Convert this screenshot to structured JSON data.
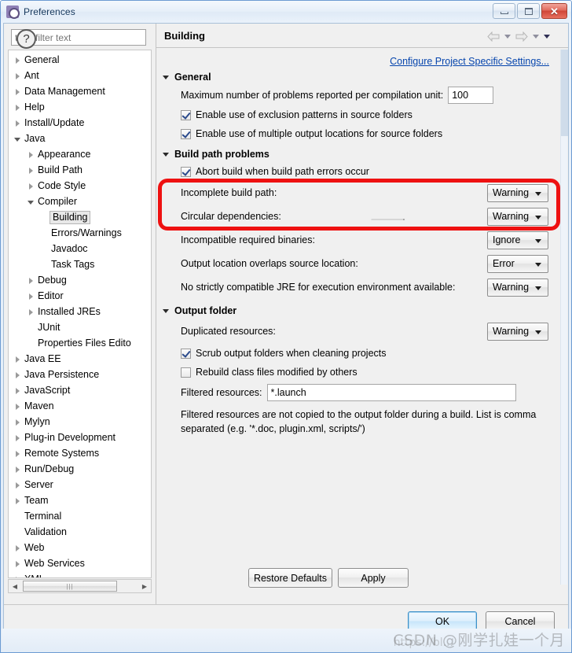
{
  "window": {
    "title": "Preferences",
    "icon": "preferences-gear-icon",
    "buttons": {
      "minimize": "minimize-icon",
      "maximize": "maximize-icon",
      "close": "✕"
    }
  },
  "sidebar": {
    "filter": {
      "value": "",
      "placeholder": "type filter text"
    },
    "items": [
      {
        "label": "General",
        "indent": 0,
        "twisty": "collapsed",
        "selected": false
      },
      {
        "label": "Ant",
        "indent": 0,
        "twisty": "collapsed",
        "selected": false
      },
      {
        "label": "Data Management",
        "indent": 0,
        "twisty": "collapsed",
        "selected": false
      },
      {
        "label": "Help",
        "indent": 0,
        "twisty": "collapsed",
        "selected": false
      },
      {
        "label": "Install/Update",
        "indent": 0,
        "twisty": "collapsed",
        "selected": false
      },
      {
        "label": "Java",
        "indent": 0,
        "twisty": "expanded",
        "selected": false
      },
      {
        "label": "Appearance",
        "indent": 1,
        "twisty": "collapsed",
        "selected": false
      },
      {
        "label": "Build Path",
        "indent": 1,
        "twisty": "collapsed",
        "selected": false
      },
      {
        "label": "Code Style",
        "indent": 1,
        "twisty": "collapsed",
        "selected": false
      },
      {
        "label": "Compiler",
        "indent": 1,
        "twisty": "expanded",
        "selected": false
      },
      {
        "label": "Building",
        "indent": 2,
        "twisty": "none",
        "selected": true
      },
      {
        "label": "Errors/Warnings",
        "indent": 2,
        "twisty": "none",
        "selected": false
      },
      {
        "label": "Javadoc",
        "indent": 2,
        "twisty": "none",
        "selected": false
      },
      {
        "label": "Task Tags",
        "indent": 2,
        "twisty": "none",
        "selected": false
      },
      {
        "label": "Debug",
        "indent": 1,
        "twisty": "collapsed",
        "selected": false
      },
      {
        "label": "Editor",
        "indent": 1,
        "twisty": "collapsed",
        "selected": false
      },
      {
        "label": "Installed JREs",
        "indent": 1,
        "twisty": "collapsed",
        "selected": false
      },
      {
        "label": "JUnit",
        "indent": 1,
        "twisty": "none",
        "selected": false
      },
      {
        "label": "Properties Files Edito",
        "indent": 1,
        "twisty": "none",
        "selected": false
      },
      {
        "label": "Java EE",
        "indent": 0,
        "twisty": "collapsed",
        "selected": false
      },
      {
        "label": "Java Persistence",
        "indent": 0,
        "twisty": "collapsed",
        "selected": false
      },
      {
        "label": "JavaScript",
        "indent": 0,
        "twisty": "collapsed",
        "selected": false
      },
      {
        "label": "Maven",
        "indent": 0,
        "twisty": "collapsed",
        "selected": false
      },
      {
        "label": "Mylyn",
        "indent": 0,
        "twisty": "collapsed",
        "selected": false
      },
      {
        "label": "Plug-in Development",
        "indent": 0,
        "twisty": "collapsed",
        "selected": false
      },
      {
        "label": "Remote Systems",
        "indent": 0,
        "twisty": "collapsed",
        "selected": false
      },
      {
        "label": "Run/Debug",
        "indent": 0,
        "twisty": "collapsed",
        "selected": false
      },
      {
        "label": "Server",
        "indent": 0,
        "twisty": "collapsed",
        "selected": false
      },
      {
        "label": "Team",
        "indent": 0,
        "twisty": "collapsed",
        "selected": false
      },
      {
        "label": "Terminal",
        "indent": 0,
        "twisty": "none",
        "selected": false
      },
      {
        "label": "Validation",
        "indent": 0,
        "twisty": "none",
        "selected": false
      },
      {
        "label": "Web",
        "indent": 0,
        "twisty": "collapsed",
        "selected": false
      },
      {
        "label": "Web Services",
        "indent": 0,
        "twisty": "collapsed",
        "selected": false
      },
      {
        "label": "XML",
        "indent": 0,
        "twisty": "collapsed",
        "selected": false
      }
    ]
  },
  "page": {
    "title": "Building",
    "configure_link": "Configure Project Specific Settings...",
    "nav": {
      "back": "back-arrow-icon",
      "back_menu": "chevron-down-icon",
      "forward": "forward-arrow-icon",
      "forward_menu": "chevron-down-icon",
      "view_menu": "chevron-down-icon"
    },
    "sections": [
      {
        "title": "General",
        "max_problems_label": "Maximum number of problems reported per compilation unit:",
        "max_problems_value": "100",
        "checkboxes": [
          {
            "label": "Enable use of exclusion patterns in source folders",
            "checked": true
          },
          {
            "label": "Enable use of multiple output locations for source folders",
            "checked": true
          }
        ]
      },
      {
        "title": "Build path problems",
        "abort_checkbox": {
          "label": "Abort build when build path errors occur",
          "checked": true
        },
        "rows": [
          {
            "label": "Incomplete build path:",
            "value": "Warning"
          },
          {
            "label": "Circular dependencies:",
            "value": "Warning"
          },
          {
            "label": "Incompatible required binaries:",
            "value": "Ignore"
          },
          {
            "label": "Output location overlaps source location:",
            "value": "Error"
          },
          {
            "label": "No strictly compatible JRE for execution environment available:",
            "value": "Warning"
          }
        ]
      },
      {
        "title": "Output folder",
        "duplicated_label": "Duplicated resources:",
        "duplicated_value": "Warning",
        "checkboxes": [
          {
            "label": "Scrub output folders when cleaning projects",
            "checked": true
          },
          {
            "label": "Rebuild class files modified by others",
            "checked": false
          }
        ],
        "filtered_label": "Filtered resources:",
        "filtered_value": "*.launch",
        "help_text": "Filtered resources are not copied to the output folder during a build. List is comma separated (e.g. '*.doc, plugin.xml, scripts/')"
      }
    ]
  },
  "buttons": {
    "restore_defaults": "Restore Defaults",
    "apply": "Apply",
    "ok": "OK",
    "cancel": "Cancel",
    "help": "?"
  },
  "annotation": {
    "color": "#ee1111",
    "arrow_color": "#111111"
  },
  "watermark": {
    "text": "CSDN @刚学扎娃一个月",
    "url": "https://bl..."
  }
}
